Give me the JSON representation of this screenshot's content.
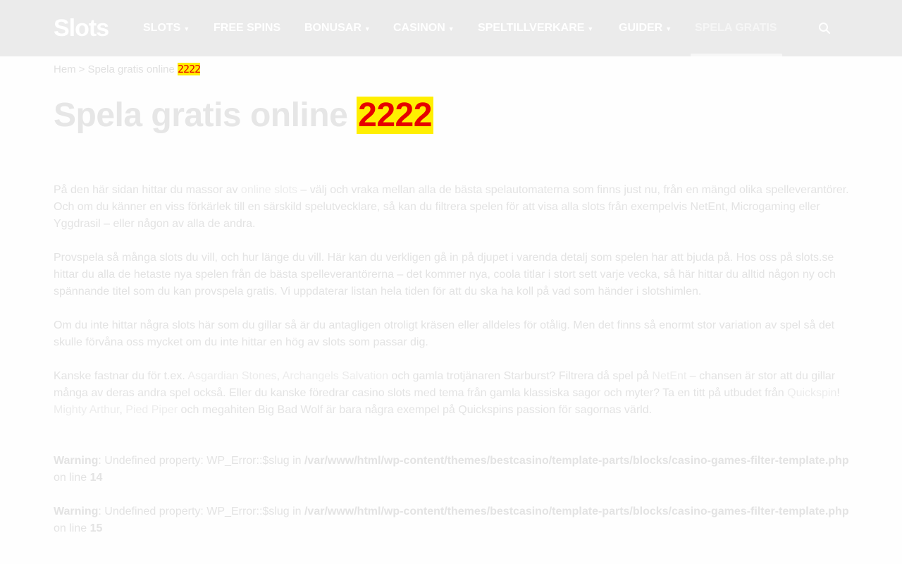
{
  "nav": {
    "logo": "Slots",
    "items": [
      {
        "label": "SLOTS",
        "caret": true
      },
      {
        "label": "FREE SPINS",
        "caret": false
      },
      {
        "label": "BONUSAR",
        "caret": true
      },
      {
        "label": "CASINON",
        "caret": true
      },
      {
        "label": "SPELTILLVERKARE",
        "caret": true
      },
      {
        "label": "GUIDER",
        "caret": true
      },
      {
        "label": "SPELA GRATIS",
        "caret": false
      }
    ]
  },
  "breadcrumb": {
    "home": "Hem",
    "separator": ">",
    "current": "Spela gratis online",
    "highlight": "2222"
  },
  "title": {
    "text": "Spela gratis online",
    "highlight": "2222"
  },
  "paragraphs": {
    "p1": {
      "a": "På den här sidan hittar du massor av ",
      "link": "online slots",
      "b": " – välj och vraka mellan alla de bästa spelautomaterna som finns just nu, från en mängd olika spelleverantörer. Och om du känner en viss förkärlek till en särskild spelutvecklare, så kan du filtrera spelen för att visa alla slots från exempelvis NetEnt, Microgaming eller Yggdrasil – eller någon av alla de andra."
    },
    "p2": "Provspela så många slots du vill, och hur länge du vill. Här kan du verkligen gå in på djupet i varenda detalj som spelen har att bjuda på. Hos oss på slots.se hittar du alla de hetaste nya spelen från de bästa spelleverantörerna – det kommer nya, coola titlar i stort sett varje vecka, så här hittar du alltid någon ny och spännande titel som du kan provspela gratis. Vi uppdaterar listan hela tiden för att du ska ha koll på vad som händer i slotshimlen.",
    "p3": "Om du inte hittar några slots här som du gillar så är du antagligen otroligt kräsen eller alldeles för otålig. Men det finns så enormt stor variation av spel så det skulle förvåna oss mycket om du inte hittar en hög av slots som passar dig.",
    "p4": {
      "a": "Kanske fastnar du för t.ex. ",
      "link1": "Asgardian Stones",
      "sep1": ", ",
      "link2": "Archangels Salvation",
      "b": " och gamla trotjänaren Starburst? Filtrera då spel på ",
      "link3": "NetEnt",
      "c": " – chansen är stor att du gillar många av deras andra spel också. Eller du kanske föredrar casino slots med tema från gamla klassiska sagor och myter? Ta en titt på utbudet från ",
      "link4": "Quickspin",
      "d": "! ",
      "link5": "Mighty Arthur",
      "sep2": ", ",
      "link6": "Pied Piper",
      "e": " och megahiten Big Bad Wolf är bara några exempel på Quickspins passion för sagornas värld."
    }
  },
  "warnings": [
    {
      "label": "Warning",
      "message": ": Undefined property: WP_Error::$slug in ",
      "path": "/var/www/html/wp-content/themes/bestcasino/template-parts/blocks/casino-games-filter-template.php",
      "online": " on line ",
      "line": "14"
    },
    {
      "label": "Warning",
      "message": ": Undefined property: WP_Error::$slug in ",
      "path": "/var/www/html/wp-content/themes/bestcasino/template-parts/blocks/casino-games-filter-template.php",
      "online": " on line ",
      "line": "15"
    }
  ]
}
